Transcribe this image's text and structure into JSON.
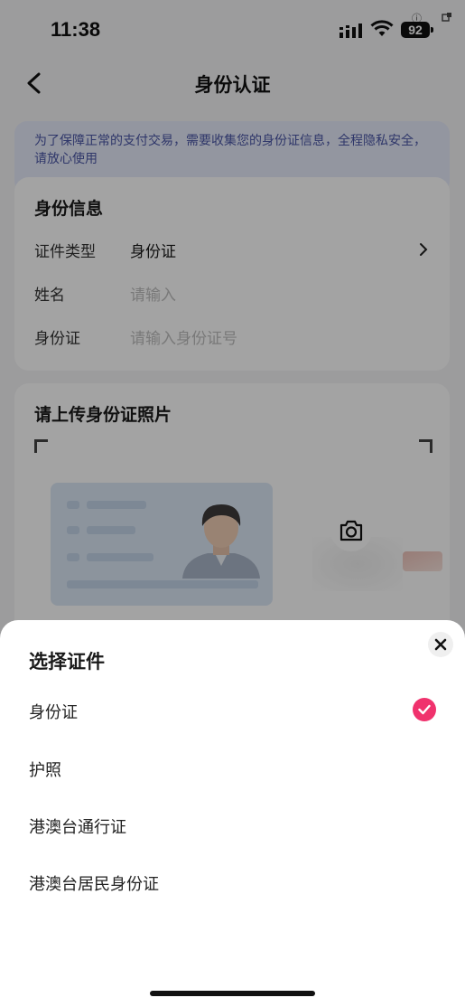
{
  "status_bar": {
    "time": "11:38",
    "battery": "92",
    "info_glyph": "ⓘ"
  },
  "header": {
    "title": "身份认证"
  },
  "notice": {
    "text": "为了保障正常的支付交易，需要收集您的身份证信息，全程隐私安全，请放心使用"
  },
  "identity_info": {
    "title": "身份信息",
    "doc_type_label": "证件类型",
    "doc_type_value": "身份证",
    "name_label": "姓名",
    "name_placeholder": "请输入",
    "id_label": "身份证",
    "id_placeholder": "请输入身份证号"
  },
  "upload": {
    "title": "请上传身份证照片"
  },
  "sheet": {
    "title": "选择证件",
    "options": [
      {
        "label": "身份证",
        "selected": true
      },
      {
        "label": "护照",
        "selected": false
      },
      {
        "label": "港澳台通行证",
        "selected": false
      },
      {
        "label": "港澳台居民身份证",
        "selected": false
      }
    ]
  },
  "colors": {
    "accent": "#f0326d",
    "notice_text": "#4a56a6",
    "notice_bg": "#e7ebfa"
  }
}
